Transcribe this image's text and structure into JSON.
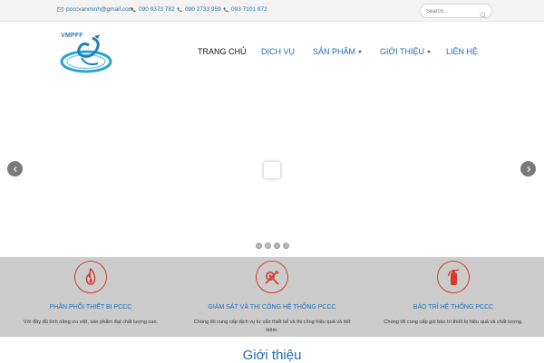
{
  "topbar": {
    "email": "pcccvanminh@gmail.com",
    "phone1": "090 9373 782",
    "phone2": "090 2733 959",
    "phone3": "093 7101 872",
    "search_placeholder": "Search..."
  },
  "logo": {
    "text": "VMPFF"
  },
  "nav": {
    "items": [
      {
        "label": "Trang chủ"
      },
      {
        "label": "Dịch vụ"
      },
      {
        "label": "Sản phẩm"
      },
      {
        "label": "Giới thiệu"
      },
      {
        "label": "Liên hệ"
      }
    ]
  },
  "services": [
    {
      "title": "Phân phối thiết bị PCCC",
      "desc": "Với đầy đủ tính năng ưu việt, sản phẩm đạt chất lượng cao."
    },
    {
      "title": "Giám sát và thi công hệ thống PCCC",
      "desc": "Chúng tôi cung cấp dịch vụ tư vấn thiết kế và thi công hiệu quả và tiết kiệm."
    },
    {
      "title": "Bảo trì hệ thống PCCC",
      "desc": "Chúng tôi cung cấp gói bảo trì thiết bị hiệu quả và chất lượng."
    }
  ],
  "section": {
    "title": "Giới thiệu"
  },
  "colors": {
    "brand_blue": "#1b6cb4",
    "accent_red": "#d23a2f",
    "services_bg": "#cccccc"
  }
}
